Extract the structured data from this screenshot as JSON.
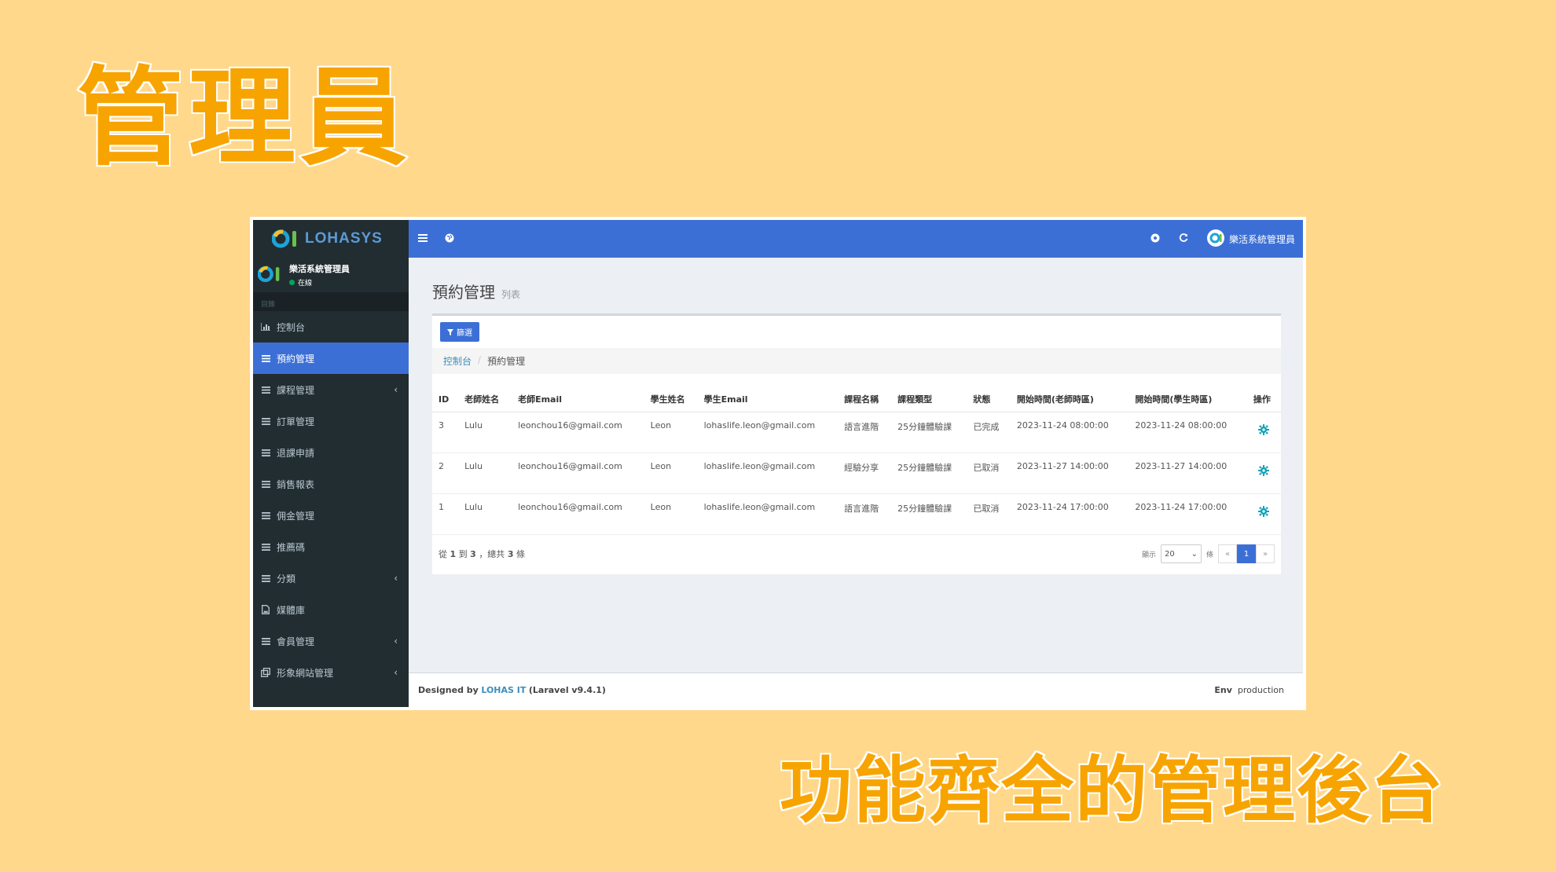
{
  "promo": {
    "top_title": "管理員",
    "bottom_title": "功能齊全的管理後台"
  },
  "brand": {
    "name": "LOHASYS"
  },
  "user": {
    "name": "樂活系統管理員",
    "status": "在線"
  },
  "sidebar": {
    "header": "目錄",
    "items": [
      {
        "label": "控制台",
        "icon": "chart-icon",
        "active": false,
        "caret": false
      },
      {
        "label": "預約管理",
        "icon": "bars-icon",
        "active": true,
        "caret": false
      },
      {
        "label": "課程管理",
        "icon": "bars-icon",
        "active": false,
        "caret": true
      },
      {
        "label": "訂單管理",
        "icon": "bars-icon",
        "active": false,
        "caret": false
      },
      {
        "label": "退課申請",
        "icon": "bars-icon",
        "active": false,
        "caret": false
      },
      {
        "label": "銷售報表",
        "icon": "bars-icon",
        "active": false,
        "caret": false
      },
      {
        "label": "佣金管理",
        "icon": "bars-icon",
        "active": false,
        "caret": false
      },
      {
        "label": "推薦碼",
        "icon": "bars-icon",
        "active": false,
        "caret": false
      },
      {
        "label": "分類",
        "icon": "bars-icon",
        "active": false,
        "caret": true
      },
      {
        "label": "媒體庫",
        "icon": "file-image-icon",
        "active": false,
        "caret": false
      },
      {
        "label": "會員管理",
        "icon": "bars-icon",
        "active": false,
        "caret": true
      },
      {
        "label": "形象網站管理",
        "icon": "clone-icon",
        "active": false,
        "caret": true
      }
    ]
  },
  "topbar": {
    "user_name": "樂活系統管理員"
  },
  "page": {
    "title": "預約管理",
    "subtitle": "列表",
    "filter_label": "篩選"
  },
  "breadcrumb": {
    "home": "控制台",
    "current": "預約管理"
  },
  "table": {
    "headers": [
      "ID",
      "老師姓名",
      "老師Email",
      "學生姓名",
      "學生Email",
      "課程名稱",
      "課程類型",
      "狀態",
      "開始時間(老師時區)",
      "開始時間(學生時區)",
      "操作"
    ],
    "rows": [
      [
        "3",
        "Lulu",
        "leonchou16@gmail.com",
        "Leon",
        "lohaslife.leon@gmail.com",
        "語言進階",
        "25分鐘體驗課",
        "已完成",
        "2023-11-24 08:00:00",
        "2023-11-24 08:00:00"
      ],
      [
        "2",
        "Lulu",
        "leonchou16@gmail.com",
        "Leon",
        "lohaslife.leon@gmail.com",
        "經驗分享",
        "25分鐘體驗課",
        "已取消",
        "2023-11-27 14:00:00",
        "2023-11-27 14:00:00"
      ],
      [
        "1",
        "Lulu",
        "leonchou16@gmail.com",
        "Leon",
        "lohaslife.leon@gmail.com",
        "語言進階",
        "25分鐘體驗課",
        "已取消",
        "2023-11-24 17:00:00",
        "2023-11-24 17:00:00"
      ]
    ]
  },
  "summary": {
    "from_label": "從",
    "from": "1",
    "to_label": "到",
    "to": "3",
    "total_label": "，總共",
    "total": "3",
    "unit": "條"
  },
  "pager": {
    "show_label": "顯示",
    "per_page": "20",
    "unit": "條",
    "prev": "«",
    "current": "1",
    "next": "»"
  },
  "footer": {
    "designed_by": "Designed by",
    "company": "LOHAS IT",
    "framework": "(Laravel v9.4.1)",
    "env_label": "Env",
    "env_value": "production"
  },
  "colors": {
    "accent": "#3c6fd6",
    "sidebar": "#222d32",
    "promo": "#f7a400",
    "background": "#ffd88c"
  }
}
